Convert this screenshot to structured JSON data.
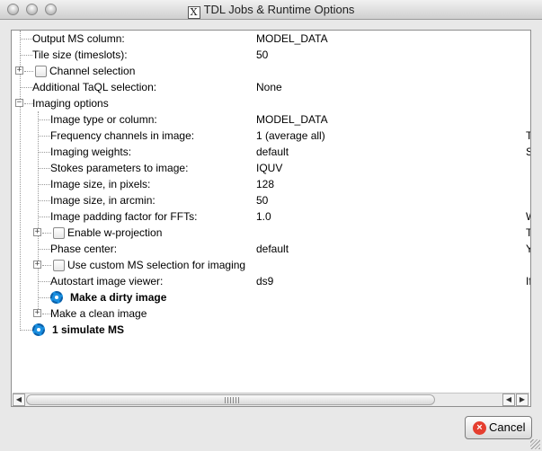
{
  "window": {
    "title": "TDL Jobs & Runtime Options"
  },
  "tree": [
    {
      "label": "Output MS column:",
      "value": "MODEL_DATA"
    },
    {
      "label": "Tile size (timeslots):",
      "value": "50"
    },
    {
      "label": "Channel selection",
      "value": ""
    },
    {
      "label": "Additional TaQL selection:",
      "value": "None"
    },
    {
      "label": "Imaging options",
      "value": ""
    },
    {
      "label": "Image type or column:",
      "value": "MODEL_DATA"
    },
    {
      "label": "Frequency channels in image:",
      "value": "1 (average all)",
      "extra": "T"
    },
    {
      "label": "Imaging weights:",
      "value": "default",
      "extra": "S"
    },
    {
      "label": "Stokes parameters to image:",
      "value": "IQUV"
    },
    {
      "label": "Image size, in pixels:",
      "value": "128"
    },
    {
      "label": "Image size, in arcmin:",
      "value": "50"
    },
    {
      "label": "Image padding factor for FFTs:",
      "value": "1.0",
      "extra": "W"
    },
    {
      "label": "Enable w-projection",
      "value": "",
      "extra": "T"
    },
    {
      "label": "Phase center:",
      "value": "default",
      "extra": "Y"
    },
    {
      "label": "Use custom MS selection for imaging",
      "value": ""
    },
    {
      "label": "Autostart image viewer:",
      "value": "ds9",
      "extra": "If"
    },
    {
      "label": "Make a dirty image",
      "value": ""
    },
    {
      "label": "Make a clean image",
      "value": ""
    },
    {
      "label": "1 simulate MS",
      "value": ""
    }
  ],
  "buttons": {
    "cancel": "Cancel"
  },
  "icons": {
    "expand": "+",
    "collapse": "−",
    "cancel": "×",
    "scroll_left": "◀",
    "scroll_right": "▶",
    "app": "X"
  },
  "colors": {
    "gear": "#1a8fe0",
    "cancel_icon": "#e53e2f"
  }
}
